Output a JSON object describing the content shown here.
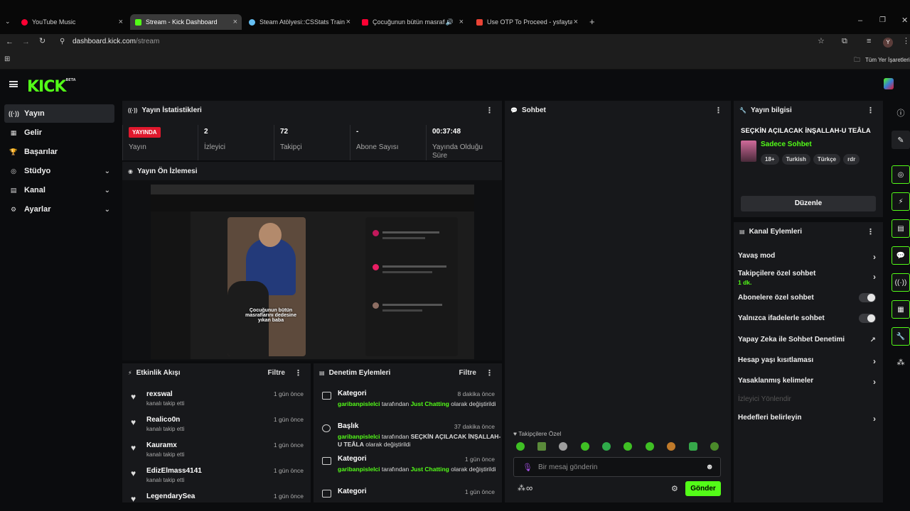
{
  "browser": {
    "tabs": [
      {
        "title": "YouTube Music",
        "color": "#ff0033"
      },
      {
        "title": "Stream - Kick Dashboard",
        "color": "#53fc18"
      },
      {
        "title": "Steam Atölyesi::CSStats Training",
        "color": "#66c0f4"
      },
      {
        "title": "Çocuğunun bütün masrafları",
        "color": "#ff0033"
      },
      {
        "title": "Use OTP To Proceed - ysfaytac",
        "color": "#ea4335"
      }
    ],
    "url_host": "dashboard.kick.com",
    "url_path": "/stream",
    "bookmarks_label": "Tüm Yer İşaretleri",
    "profile_initial": "Y"
  },
  "brand": {
    "logo": "KICK",
    "logo_sup": "BETA",
    "accent": "#53fc18"
  },
  "sidebar": {
    "items": [
      {
        "label": "Yayın",
        "icon": "broadcast-icon",
        "glyph": "((·))",
        "chevron": false
      },
      {
        "label": "Gelir",
        "icon": "revenue-icon",
        "glyph": "▦",
        "chevron": false
      },
      {
        "label": "Başarılar",
        "icon": "trophy-icon",
        "glyph": "🏆",
        "chevron": false
      },
      {
        "label": "Stüdyo",
        "icon": "studio-icon",
        "glyph": "◎",
        "chevron": true
      },
      {
        "label": "Kanal",
        "icon": "channel-icon",
        "glyph": "▤",
        "chevron": true
      },
      {
        "label": "Ayarlar",
        "icon": "settings-icon",
        "glyph": "⚙",
        "chevron": true
      }
    ]
  },
  "stats": {
    "title": "Yayın İstatistikleri",
    "live_badge": "YAYINDA",
    "live_label": "Yayın",
    "items": [
      {
        "value": "2",
        "label": "İzleyici"
      },
      {
        "value": "72",
        "label": "Takipçi"
      },
      {
        "value": "-",
        "label": "Abone Sayısı"
      },
      {
        "value": "00:37:48",
        "label": "Yayında Olduğu Süre"
      }
    ]
  },
  "preview": {
    "title": "Yayın Ön İzlemesi",
    "caption": "Çocuğunun bütün masraflarını dedesine yıkan baba"
  },
  "activity": {
    "title": "Etkinlik Akışı",
    "filter": "Filtre",
    "items": [
      {
        "user": "rexswal",
        "action": "kanalı takip etti",
        "time": "1 gün önce"
      },
      {
        "user": "Realico0n",
        "action": "kanalı takip etti",
        "time": "1 gün önce"
      },
      {
        "user": "Kauramx",
        "action": "kanalı takip etti",
        "time": "1 gün önce"
      },
      {
        "user": "EdizElmass4141",
        "action": "kanalı takip etti",
        "time": "1 gün önce"
      },
      {
        "user": "LegendarySea",
        "action": "",
        "time": "1 gün önce"
      }
    ]
  },
  "moderation": {
    "title": "Denetim Eylemleri",
    "filter": "Filtre",
    "items": [
      {
        "title": "Kategori",
        "time": "8 dakika önce",
        "actor": "garibanpislelci",
        "mid": "tarafından",
        "target": "Just Chatting",
        "end": "olarak değiştirildi"
      },
      {
        "title": "Başlık",
        "time": "37 dakika önce",
        "actor": "garibanpislelci",
        "mid": "tarafından",
        "target": "SEÇKİN AÇILACAK İNŞALLAH-U TEÂLA",
        "end": "olarak değiştirildi"
      },
      {
        "title": "Kategori",
        "time": "1 gün önce",
        "actor": "garibanpislelci",
        "mid": "tarafından",
        "target": "Just Chatting",
        "end": "olarak değiştirildi"
      },
      {
        "title": "Kategori",
        "time": "1 gün önce",
        "actor": "",
        "mid": "",
        "target": "",
        "end": ""
      }
    ]
  },
  "chat": {
    "title": "Sohbet",
    "followers_only": "Takipçilere Özel",
    "placeholder": "Bir mesaj gönderin",
    "send": "Gönder",
    "infinity": "∞"
  },
  "stream_info": {
    "title": "Yayın bilgisi",
    "stream_title": "SEÇKİN AÇILACAK İNŞALLAH-U TEÂLA",
    "category": "Sadece Sohbet",
    "tags": [
      "18+",
      "Turkish",
      "Türkçe",
      "rdr"
    ],
    "edit": "Düzenle"
  },
  "channel_actions": {
    "title": "Kanal Eylemleri",
    "slow_mode": "Yavaş mod",
    "followers_chat": "Takipçilere özel sohbet",
    "followers_chat_value": "1 dk.",
    "subscribers_chat": "Abonelere özel sohbet",
    "emotes_chat": "Yalnızca ifadelerle sohbet",
    "ai_moderation": "Yapay Zeka ile Sohbet Denetimi",
    "account_age": "Hesap yaşı kısıtlaması",
    "banned_words": "Yasaklanmış kelimeler",
    "viewer_redirect": "İzleyici Yönlendir",
    "set_goals": "Hedefleri belirleyin"
  }
}
